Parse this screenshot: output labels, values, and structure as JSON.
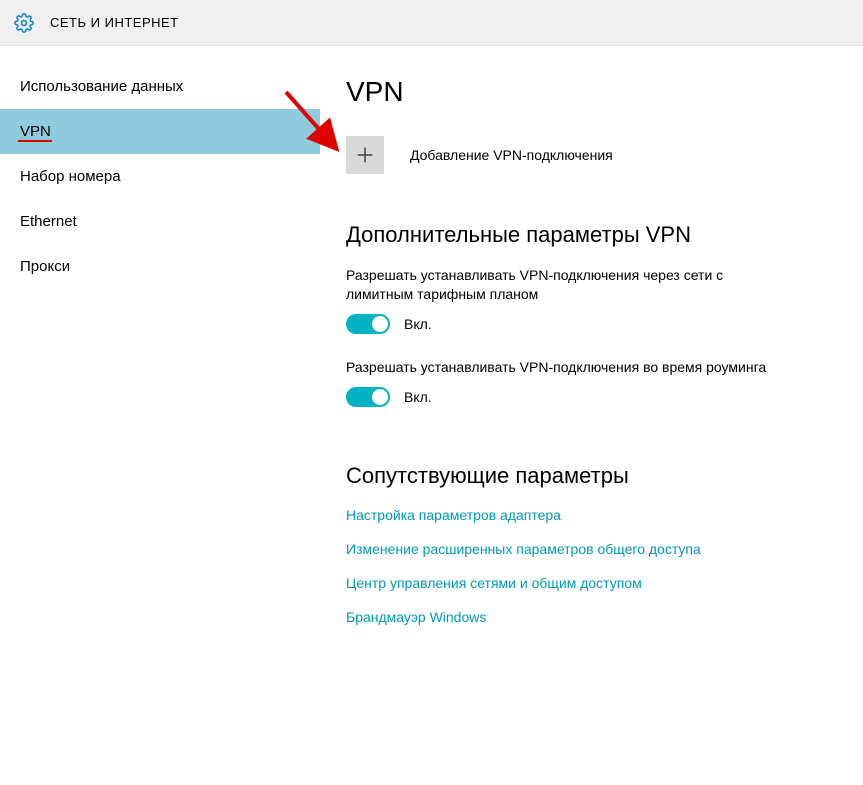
{
  "header": {
    "title": "СЕТЬ И ИНТЕРНЕТ"
  },
  "sidebar": {
    "items": [
      {
        "label": "Использование данных",
        "active": false
      },
      {
        "label": "VPN",
        "active": true
      },
      {
        "label": "Набор номера",
        "active": false
      },
      {
        "label": "Ethernet",
        "active": false
      },
      {
        "label": "Прокси",
        "active": false
      }
    ]
  },
  "main": {
    "title": "VPN",
    "add_label": "Добавление VPN-подключения",
    "advanced_title": "Дополнительные параметры VPN",
    "toggle1_desc": "Разрешать устанавливать VPN-подключения через сети с лимитным тарифным планом",
    "toggle1_label": "Вкл.",
    "toggle2_desc": "Разрешать устанавливать VPN-подключения во время роуминга",
    "toggle2_label": "Вкл.",
    "related_title": "Сопутствующие параметры",
    "links": [
      "Настройка параметров адаптера",
      "Изменение расширенных параметров общего доступа",
      "Центр управления сетями и общим доступом",
      "Брандмауэр Windows"
    ]
  }
}
